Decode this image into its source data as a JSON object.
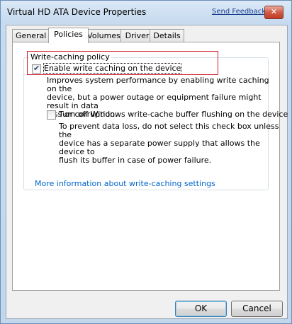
{
  "window": {
    "title": "Virtual HD ATA Device Properties",
    "feedback_link": "Send Feedback",
    "close_glyph": "✕"
  },
  "tabs": [
    {
      "label": "General"
    },
    {
      "label": "Policies"
    },
    {
      "label": "Volumes"
    },
    {
      "label": "Driver"
    },
    {
      "label": "Details"
    }
  ],
  "active_tab": "Policies",
  "policy": {
    "group_title": "Write-caching policy",
    "enable_cache": {
      "label": "Enable write caching on the device",
      "checked": true,
      "desc": [
        "Improves system performance by enabling write caching on the",
        "device, but a power outage or equipment failure might result in data",
        "loss or corruption."
      ]
    },
    "turn_off_flush": {
      "label": "Turn off Windows write-cache buffer flushing on the device",
      "checked": false,
      "desc": [
        "To prevent data loss, do not select this check box unless the",
        "device has a separate power supply that allows the device to",
        "flush its buffer in case of power failure."
      ]
    },
    "info_link": "More information about write-caching settings"
  },
  "buttons": {
    "ok": "OK",
    "cancel": "Cancel"
  },
  "checkmark_glyph": "✔"
}
